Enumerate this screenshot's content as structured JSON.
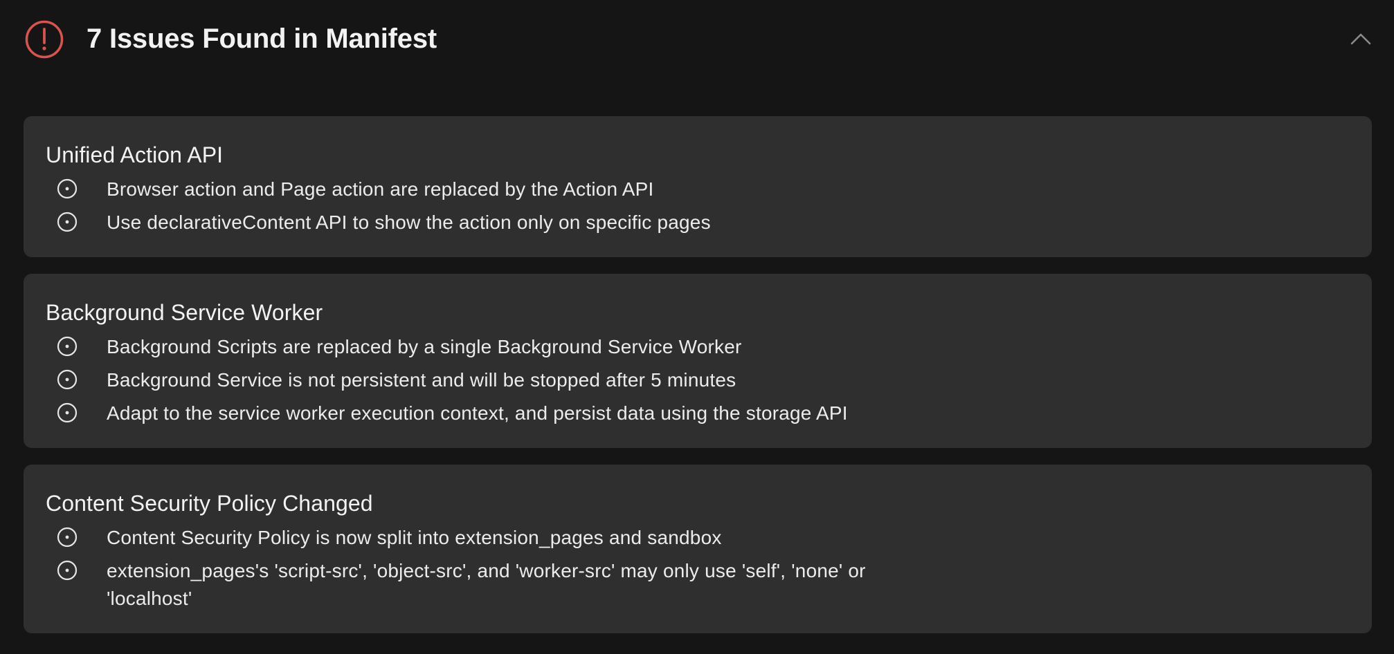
{
  "header": {
    "title": "7 Issues Found in Manifest",
    "alert_color": "#d9534f",
    "alert_icon": "exclamation-circle",
    "collapse_icon": "chevron-up"
  },
  "sections": [
    {
      "title": "Unified Action API",
      "items": [
        "Browser action and Page action are replaced by the Action API",
        "Use declarativeContent API to show the action only on specific pages"
      ]
    },
    {
      "title": "Background Service Worker",
      "items": [
        "Background Scripts are replaced by a single Background Service Worker",
        "Background Service is not persistent and will be stopped after 5 minutes",
        "Adapt to the service worker execution context, and persist data using the storage API"
      ]
    },
    {
      "title": "Content Security Policy Changed",
      "items": [
        "Content Security Policy is now split into extension_pages and sandbox",
        "extension_pages's 'script-src', 'object-src', and 'worker-src' may only use 'self', 'none' or 'localhost'"
      ]
    }
  ]
}
